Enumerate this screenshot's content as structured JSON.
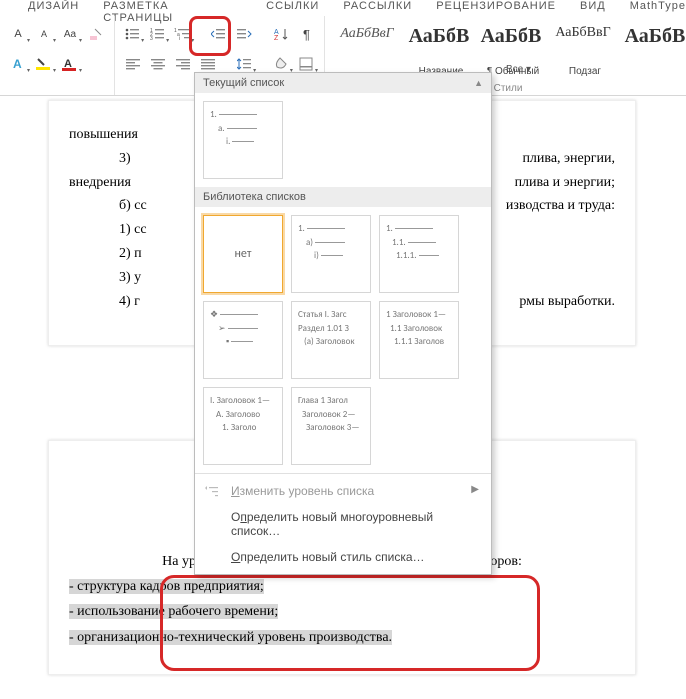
{
  "tabs": [
    "ДИЗАЙН",
    "РАЗМЕТКА СТРАНИЦЫ",
    "ССЫЛКИ",
    "РАССЫЛКИ",
    "РЕЦЕНЗИРОВАНИЕ",
    "ВИД",
    "MathType"
  ],
  "styles_group_label": "Стили",
  "style_cards": [
    {
      "sample": "АаБбВвГ",
      "name": ""
    },
    {
      "sample": "АаБбВ",
      "name": "Название"
    },
    {
      "sample": "АаБбВ",
      "name": "¶ Обычный"
    },
    {
      "sample": "АаБбВвГ",
      "name": "Подзаг"
    },
    {
      "sample": "АаБбВ",
      "name": ""
    }
  ],
  "style_more": "Все ▾",
  "dropdown": {
    "current_label": "Текущий список",
    "library_label": "Библиотека списков",
    "none_label": "нет",
    "thumbs": {
      "current": [
        "1.",
        "a.",
        "i."
      ],
      "lib": [
        [
          "1.",
          "a)",
          "i)"
        ],
        [
          "1.",
          "1.1.",
          "1.1.1."
        ],
        [
          "❖",
          "➢",
          "▪"
        ],
        [
          "Статья I. Загс",
          "Раздел 1.01 З",
          "(a) Заголовок"
        ],
        [
          "1 Заголовок 1—",
          "1.1 Заголовок",
          "1.1.1 Заголов"
        ],
        [
          "I. Заголовок 1—",
          "A. Заголово",
          "1. Заголо"
        ],
        [
          "Глава 1 Загол",
          "Заголовок 2—",
          "Заголовок 3—"
        ]
      ]
    },
    "menu": {
      "change_level": "Изменить уровень списка",
      "define_ml": "Определить новый многоуровневый список…",
      "define_style": "Определить новый стиль списка…"
    }
  },
  "doc1": {
    "p1": "повышения",
    "l3": "3)",
    "l3_tail": "плива, энергии,",
    "p2": "внедрения",
    "p2_tail": "плива и энергии;",
    "lb": "б) сс",
    "lb_tail": "изводства и труда:",
    "l1": "1) сс",
    "l2": "2) п",
    "l3b": "3) у",
    "l4": "4) г",
    "l4_tail": "рмы выработки."
  },
  "doc2": {
    "lead": "На уровень производительности труда влияет ряд факторов:",
    "b1": "- структура кадров предприятия;",
    "b2": "- использование рабочего времени;",
    "b3": "- организационно-технический уровень производства."
  }
}
